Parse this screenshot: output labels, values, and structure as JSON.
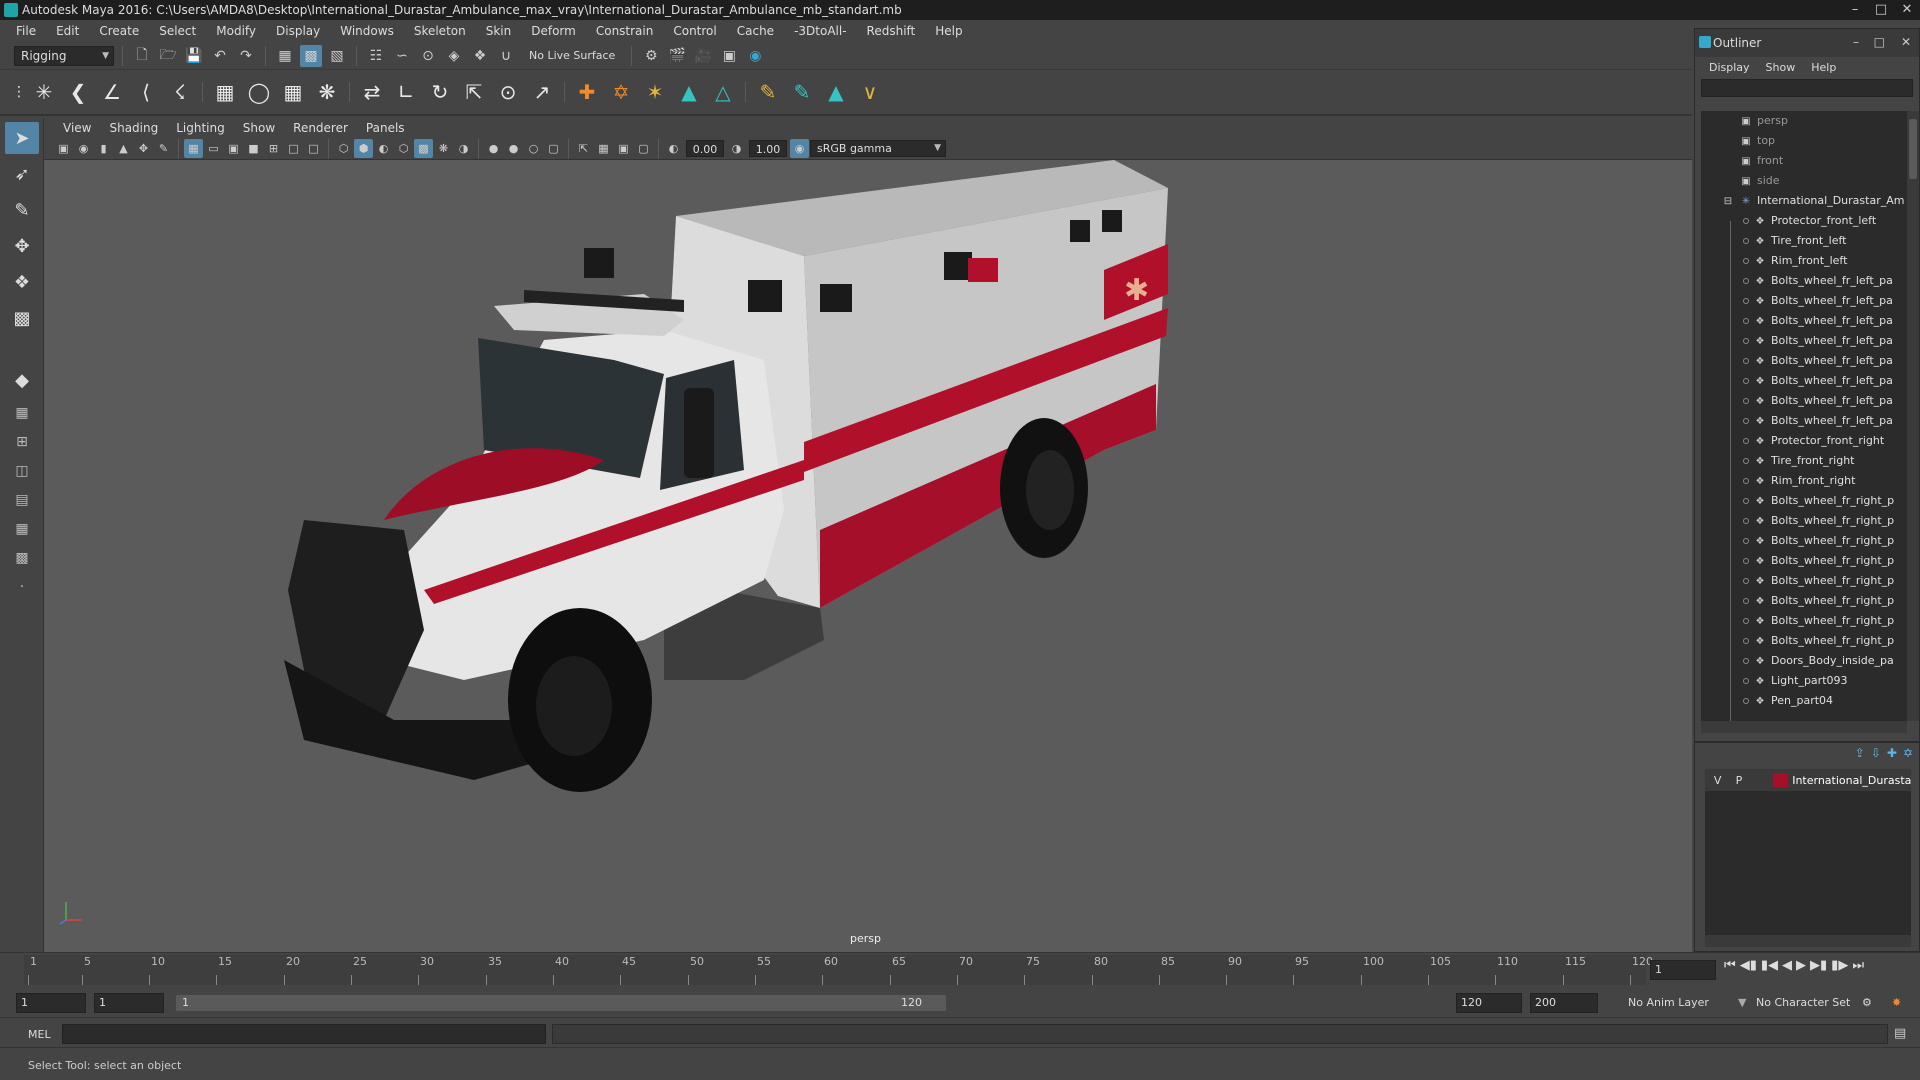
{
  "window": {
    "title": "Autodesk Maya 2016: C:\\Users\\AMDA8\\Desktop\\International_Durastar_Ambulance_max_vray\\International_Durastar_Ambulance_mb_standart.mb"
  },
  "menu": [
    "File",
    "Edit",
    "Create",
    "Select",
    "Modify",
    "Display",
    "Windows",
    "Skeleton",
    "Skin",
    "Deform",
    "Constrain",
    "Control",
    "Cache",
    "-3DtoAll-",
    "Redshift",
    "Help"
  ],
  "status": {
    "menuset": "Rigging",
    "live_surface": "No Live Surface"
  },
  "viewport": {
    "menu": [
      "View",
      "Shading",
      "Lighting",
      "Show",
      "Renderer",
      "Panels"
    ],
    "exposure": "0.00",
    "gamma": "1.00",
    "color_space": "sRGB gamma",
    "camera": "persp"
  },
  "outliner": {
    "title": "Outliner",
    "menu": [
      "Display",
      "Show",
      "Help"
    ],
    "cameras": [
      "persp",
      "top",
      "front",
      "side"
    ],
    "group": "International_Durastar_Am",
    "items": [
      "Protector_front_left",
      "Tire_front_left",
      "Rim_front_left",
      "Bolts_wheel_fr_left_pa",
      "Bolts_wheel_fr_left_pa",
      "Bolts_wheel_fr_left_pa",
      "Bolts_wheel_fr_left_pa",
      "Bolts_wheel_fr_left_pa",
      "Bolts_wheel_fr_left_pa",
      "Bolts_wheel_fr_left_pa",
      "Bolts_wheel_fr_left_pa",
      "Protector_front_right",
      "Tire_front_right",
      "Rim_front_right",
      "Bolts_wheel_fr_right_p",
      "Bolts_wheel_fr_right_p",
      "Bolts_wheel_fr_right_p",
      "Bolts_wheel_fr_right_p",
      "Bolts_wheel_fr_right_p",
      "Bolts_wheel_fr_right_p",
      "Bolts_wheel_fr_right_p",
      "Bolts_wheel_fr_right_p",
      "Doors_Body_inside_pa",
      "Light_part093",
      "Pen_part04"
    ]
  },
  "layers": {
    "v": "V",
    "p": "P",
    "name": "International_Durastar",
    "color": "#a50f2a"
  },
  "timeline": {
    "ticks": [
      "1",
      "5",
      "10",
      "15",
      "20",
      "25",
      "30",
      "35",
      "40",
      "45",
      "50",
      "55",
      "60",
      "65",
      "70",
      "75",
      "80",
      "85",
      "90",
      "95",
      "100",
      "105",
      "110",
      "115",
      "120"
    ],
    "current": "1",
    "range_start": "1",
    "play_start": "1",
    "slider_start": "1",
    "slider_end": "120",
    "play_end": "120",
    "range_end": "200",
    "anim_layer": "No Anim Layer",
    "char_set": "No Character Set"
  },
  "cmd": {
    "lang": "MEL"
  },
  "help": "Select Tool: select an object"
}
